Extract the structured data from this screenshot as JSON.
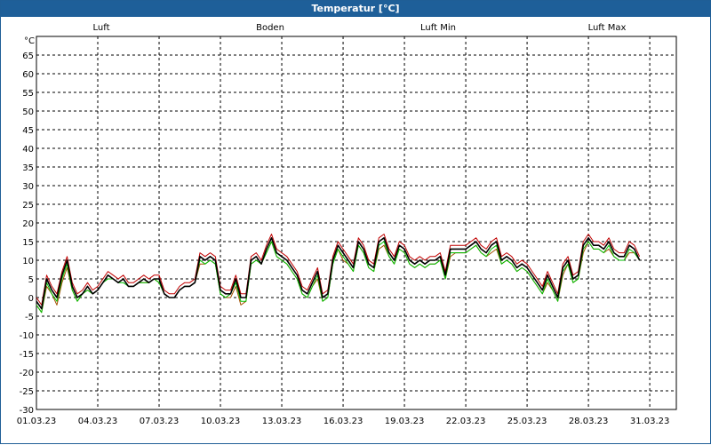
{
  "window": {
    "title": "Temperatur [°C]"
  },
  "chart_data": {
    "type": "line",
    "title": "Temperatur [°C]",
    "ylabel": "°C",
    "ylim": [
      -30,
      70
    ],
    "yticks": [
      65,
      60,
      55,
      50,
      45,
      40,
      35,
      30,
      25,
      20,
      15,
      10,
      5,
      0,
      -5,
      -10,
      -15,
      -20,
      -25,
      -30
    ],
    "xlim": [
      0,
      31.3
    ],
    "xticks": [
      {
        "day": 0,
        "label": "01.03.23"
      },
      {
        "day": 3,
        "label": "04.03.23"
      },
      {
        "day": 6,
        "label": "07.03.23"
      },
      {
        "day": 9,
        "label": "10.03.23"
      },
      {
        "day": 12,
        "label": "13.03.23"
      },
      {
        "day": 15,
        "label": "16.03.23"
      },
      {
        "day": 18,
        "label": "19.03.23"
      },
      {
        "day": 21,
        "label": "22.03.23"
      },
      {
        "day": 24,
        "label": "25.03.23"
      },
      {
        "day": 27,
        "label": "28.03.23"
      },
      {
        "day": 30,
        "label": "31.03.23"
      }
    ],
    "grid": true,
    "legend_position": "top",
    "x": [
      0,
      0.25,
      0.5,
      0.75,
      1,
      1.25,
      1.5,
      1.75,
      2,
      2.25,
      2.5,
      2.75,
      3,
      3.25,
      3.5,
      3.75,
      4,
      4.25,
      4.5,
      4.75,
      5,
      5.25,
      5.5,
      5.75,
      6,
      6.25,
      6.5,
      6.75,
      7,
      7.25,
      7.5,
      7.75,
      8,
      8.25,
      8.5,
      8.75,
      9,
      9.25,
      9.5,
      9.75,
      10,
      10.25,
      10.5,
      10.75,
      11,
      11.25,
      11.5,
      11.75,
      12,
      12.25,
      12.5,
      12.75,
      13,
      13.25,
      13.5,
      13.75,
      14,
      14.25,
      14.5,
      14.75,
      15,
      15.25,
      15.5,
      15.75,
      16,
      16.25,
      16.5,
      16.75,
      17,
      17.25,
      17.5,
      17.75,
      18,
      18.25,
      18.5,
      18.75,
      19,
      19.25,
      19.5,
      19.75,
      20,
      20.25,
      20.5,
      20.75,
      21,
      21.25,
      21.5,
      21.75,
      22,
      22.25,
      22.5,
      22.75,
      23,
      23.25,
      23.5,
      23.75,
      24,
      24.25,
      24.5,
      24.75,
      25,
      25.25,
      25.5,
      25.75,
      26,
      26.25,
      26.5,
      26.75,
      27,
      27.25,
      27.5,
      27.75,
      28,
      28.25,
      28.5,
      28.75,
      29,
      29.25,
      29.5,
      29.75,
      30,
      30.25,
      30.5,
      30.75,
      31,
      31.25
    ],
    "series": [
      {
        "name": "Luft",
        "color": "#0000c0",
        "values": [
          -1,
          -3,
          5,
          2,
          0,
          6,
          10,
          3,
          0,
          1,
          3,
          1,
          2,
          4,
          6,
          5,
          4,
          5,
          3,
          3,
          4,
          5,
          4,
          5,
          5,
          1,
          0,
          0,
          2,
          3,
          3,
          4,
          11,
          10,
          11,
          10,
          2,
          1,
          1,
          5,
          0,
          0,
          10,
          11,
          9,
          13,
          16,
          12,
          11,
          10,
          8,
          6,
          2,
          1,
          4,
          7,
          0,
          1,
          10,
          14,
          12,
          10,
          8,
          15,
          13,
          9,
          8,
          15,
          16,
          12,
          10,
          14,
          13,
          10,
          9,
          10,
          9,
          10,
          10,
          11,
          6,
          13,
          13,
          13,
          13,
          14,
          15,
          13,
          12,
          14,
          15,
          10,
          11,
          10,
          8,
          9,
          8,
          6,
          4,
          2,
          6,
          3,
          0,
          8,
          10,
          5,
          6,
          14,
          16,
          14,
          14,
          13,
          15,
          12,
          11,
          11,
          14,
          13,
          10
        ]
      },
      {
        "name": "Boden",
        "color": "#a05000",
        "values": [
          -2,
          -4,
          3,
          1,
          -2,
          4,
          8,
          2,
          -1,
          1,
          2,
          1,
          2,
          4,
          6,
          5,
          4,
          5,
          3,
          3,
          4,
          4,
          4,
          5,
          4,
          1,
          0,
          0,
          2,
          3,
          3,
          4,
          9,
          9,
          10,
          9,
          1,
          0,
          0,
          3,
          -2,
          -1,
          9,
          10,
          9,
          12,
          15,
          11,
          10,
          9,
          7,
          5,
          1,
          0,
          3,
          5,
          -1,
          0,
          9,
          13,
          10,
          9,
          7,
          14,
          12,
          8,
          7,
          13,
          14,
          11,
          9,
          13,
          12,
          9,
          8,
          9,
          8,
          9,
          9,
          10,
          5,
          11,
          12,
          12,
          12,
          13,
          14,
          12,
          11,
          12,
          13,
          9,
          10,
          9,
          7,
          8,
          7,
          5,
          3,
          1,
          4,
          2,
          -1,
          6,
          9,
          4,
          5,
          12,
          15,
          13,
          13,
          12,
          13,
          11,
          10,
          10,
          12,
          12,
          10
        ]
      },
      {
        "name": "Luft Min",
        "color": "#00c000",
        "values": [
          -2,
          -4,
          4,
          1,
          -1,
          5,
          9,
          2,
          -1,
          1,
          2,
          1,
          2,
          4,
          5,
          5,
          4,
          4,
          3,
          3,
          4,
          4,
          4,
          5,
          4,
          1,
          0,
          0,
          2,
          3,
          3,
          4,
          10,
          9,
          10,
          9,
          1,
          0,
          1,
          4,
          -1,
          -1,
          9,
          10,
          9,
          12,
          15,
          11,
          10,
          9,
          7,
          5,
          1,
          0,
          3,
          6,
          -1,
          0,
          9,
          13,
          11,
          9,
          7,
          14,
          12,
          8,
          7,
          14,
          15,
          11,
          9,
          13,
          12,
          9,
          8,
          9,
          8,
          9,
          9,
          10,
          5,
          12,
          12,
          12,
          12,
          13,
          14,
          12,
          11,
          13,
          14,
          9,
          10,
          9,
          7,
          8,
          7,
          5,
          3,
          1,
          5,
          2,
          -1,
          7,
          9,
          4,
          5,
          13,
          15,
          13,
          13,
          12,
          14,
          11,
          10,
          10,
          13,
          12,
          10
        ]
      },
      {
        "name": "Luft Max",
        "color": "#c00000",
        "values": [
          0,
          -2,
          6,
          3,
          1,
          7,
          11,
          4,
          1,
          2,
          4,
          2,
          3,
          5,
          7,
          6,
          5,
          6,
          4,
          4,
          5,
          6,
          5,
          6,
          6,
          2,
          1,
          1,
          3,
          4,
          4,
          5,
          12,
          11,
          12,
          11,
          3,
          2,
          2,
          6,
          1,
          1,
          11,
          12,
          10,
          14,
          17,
          13,
          12,
          11,
          9,
          7,
          3,
          2,
          5,
          8,
          1,
          2,
          11,
          15,
          13,
          11,
          9,
          16,
          14,
          10,
          9,
          16,
          17,
          13,
          11,
          15,
          14,
          11,
          10,
          11,
          10,
          11,
          11,
          12,
          7,
          14,
          14,
          14,
          14,
          15,
          16,
          14,
          13,
          15,
          16,
          11,
          12,
          11,
          9,
          10,
          9,
          7,
          5,
          3,
          7,
          4,
          1,
          9,
          11,
          6,
          7,
          15,
          17,
          15,
          15,
          14,
          16,
          13,
          12,
          12,
          15,
          14,
          11
        ]
      }
    ]
  }
}
